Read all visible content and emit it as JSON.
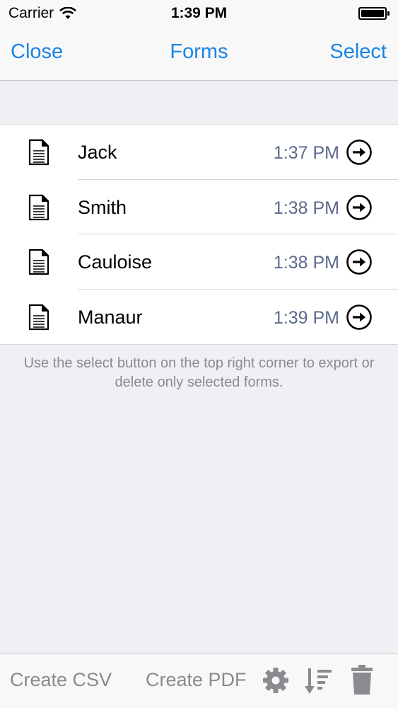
{
  "status_bar": {
    "carrier": "Carrier",
    "time": "1:39 PM"
  },
  "nav": {
    "close_label": "Close",
    "title": "Forms",
    "select_label": "Select"
  },
  "forms": [
    {
      "name": "Jack",
      "time": "1:37 PM"
    },
    {
      "name": "Smith",
      "time": "1:38 PM"
    },
    {
      "name": "Cauloise",
      "time": "1:38 PM"
    },
    {
      "name": "Manaur",
      "time": "1:39 PM"
    }
  ],
  "hint": "Use the select button on the top right corner to export or delete only selected forms.",
  "toolbar": {
    "create_csv_label": "Create CSV",
    "create_pdf_label": "Create PDF",
    "icons": [
      "gear-icon",
      "sort-icon",
      "trash-icon"
    ]
  },
  "colors": {
    "accent": "#1a84e5",
    "time_text": "#5b6a8e",
    "disabled": "#8a8a8f",
    "background": "#efeff4"
  }
}
